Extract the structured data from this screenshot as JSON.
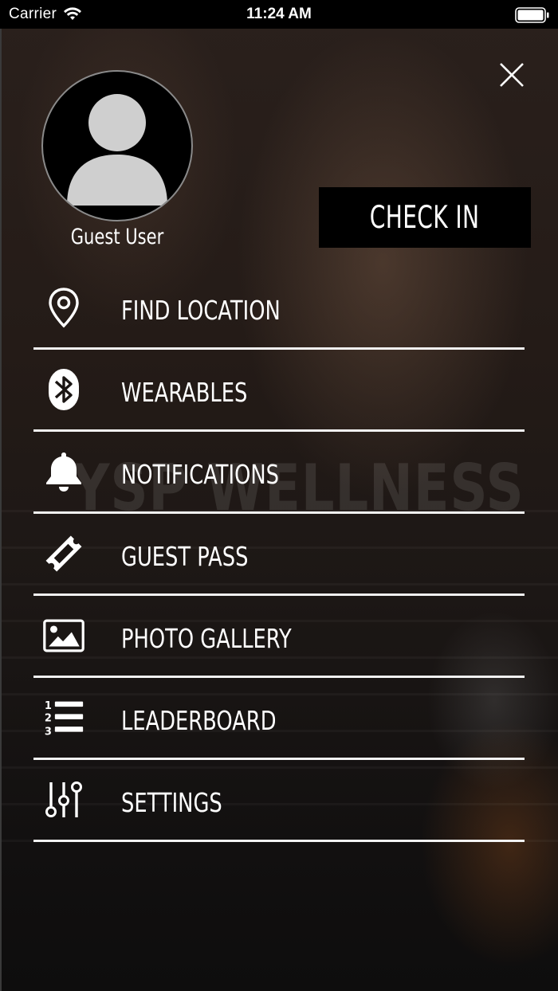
{
  "status_bar": {
    "carrier": "Carrier",
    "time": "11:24 AM"
  },
  "profile": {
    "name": "Guest User"
  },
  "check_in": {
    "label": "CHECK IN"
  },
  "watermark": "YSP WELLNESS",
  "menu": [
    {
      "label": "FIND LOCATION",
      "icon": "location-pin-icon"
    },
    {
      "label": "WEARABLES",
      "icon": "bluetooth-icon"
    },
    {
      "label": "NOTIFICATIONS",
      "icon": "bell-icon"
    },
    {
      "label": "GUEST PASS",
      "icon": "ticket-icon"
    },
    {
      "label": "PHOTO GALLERY",
      "icon": "image-icon"
    },
    {
      "label": "LEADERBOARD",
      "icon": "ranked-list-icon"
    },
    {
      "label": "SETTINGS",
      "icon": "sliders-icon"
    }
  ],
  "colors": {
    "accent": "#ffffff",
    "button_bg": "#000000",
    "divider": "#f2f2f2"
  }
}
